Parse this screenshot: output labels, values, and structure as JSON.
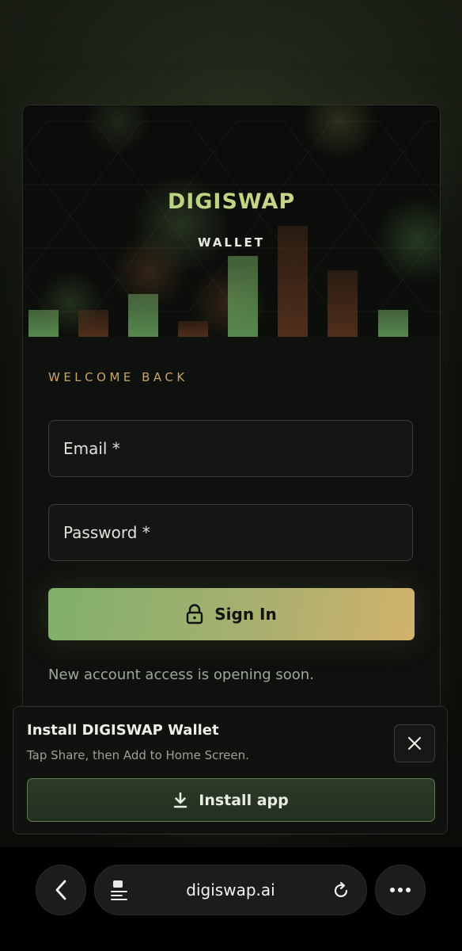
{
  "brand": {
    "name": "DIGISWAP",
    "subtitle": "WALLET"
  },
  "login": {
    "heading": "WELCOME BACK",
    "email_label": "Email *",
    "password_label": "Password *",
    "signin_label": "Sign In",
    "note": "New account access is opening soon."
  },
  "install_banner": {
    "title": "Install DIGISWAP Wallet",
    "description": "Tap Share, then Add to Home Screen.",
    "button_label": "Install app"
  },
  "browser": {
    "url": "digiswap.ai"
  },
  "icons": {
    "lock": "lock-icon",
    "close": "close-icon",
    "download": "download-icon",
    "back": "chevron-left-icon",
    "page": "page-menu-icon",
    "reload": "reload-icon",
    "more": "more-icon"
  },
  "colors": {
    "brand_gradient_start": "#a9cf7f",
    "brand_gradient_end": "#d9d98a",
    "welcome": "#c9a46a",
    "signin_gradient_start": "#7fb06a",
    "signin_gradient_end": "#d1b26b",
    "install_button_border": "#5f7a52"
  }
}
